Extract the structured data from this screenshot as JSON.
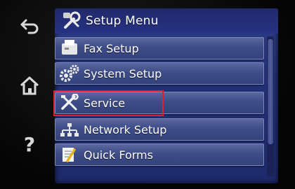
{
  "side_buttons": [
    {
      "name": "back-icon"
    },
    {
      "name": "home-icon"
    },
    {
      "name": "help-icon",
      "label": "?"
    }
  ],
  "header": {
    "title": "Setup Menu",
    "icon": "wrench-screwdriver-icon"
  },
  "menu": {
    "items": [
      {
        "label": "Fax Setup",
        "icon": "fax-icon"
      },
      {
        "label": "System Setup",
        "icon": "gears-icon"
      },
      {
        "label": "Service",
        "icon": "tools-icon"
      },
      {
        "label": "Network Setup",
        "icon": "network-icon"
      },
      {
        "label": "Quick Forms",
        "icon": "form-pencil-icon"
      }
    ]
  },
  "highlight_color": "#e0202a"
}
